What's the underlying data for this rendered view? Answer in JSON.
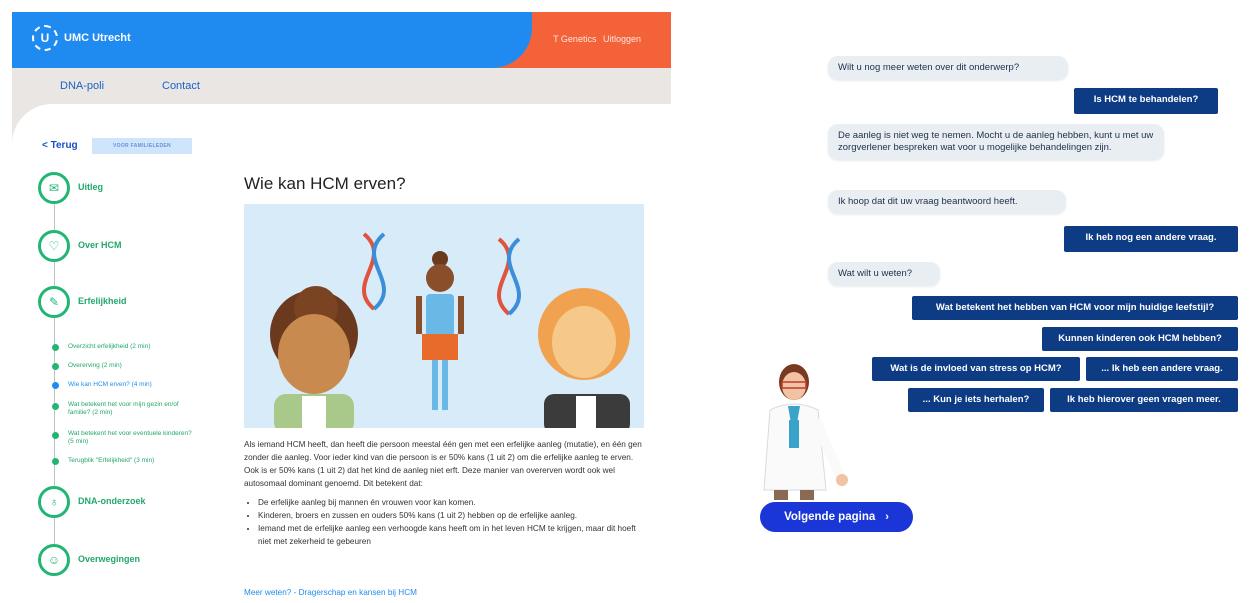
{
  "portal": {
    "brand": "UMC Utrecht",
    "logo_letter": "U",
    "user": {
      "name": "T Genetics",
      "logout": "Uitloggen"
    },
    "nav": [
      "DNA-poli",
      "Contact"
    ],
    "back": "< Terug",
    "badge": "VOOR FAMILIELEDEN",
    "steps": [
      {
        "label": "Uitleg",
        "icon": "envelope-icon"
      },
      {
        "label": "Over HCM",
        "icon": "heart-icon"
      },
      {
        "label": "Erfelijkheid",
        "icon": "dna-icon"
      },
      {
        "label": "DNA-onderzoek",
        "icon": "flask-icon"
      },
      {
        "label": "Overwegingen",
        "icon": "person-icon"
      }
    ],
    "substeps": [
      "Overzicht erfelijkheid (2 min)",
      "Overerving (2 min)",
      "Wie kan HCM erven? (4 min)",
      "Wat betekent het voor mijn gezin en/of familie? (2 min)",
      "Wat betekent het voor eventuele kinderen? (5 min)",
      "Terugblik \"Erfelijkheid\" (3 min)"
    ],
    "title": "Wie kan HCM erven?",
    "paragraph": "Als iemand HCM heeft, dan heeft die persoon meestal één gen met een erfelijke aanleg (mutatie), en één gen zonder die aanleg. Voor ieder kind van die persoon is er 50% kans (1 uit 2) om die erfelijke aanleg te erven. Ook is er 50% kans (1 uit 2) dat het kind de aanleg niet erft. Deze manier van overerven wordt ook wel autosomaal dominant genoemd. Dit betekent dat:",
    "bullets": [
      "De erfelijke aanleg bij mannen én vrouwen voor kan komen.",
      "Kinderen, broers en zussen en ouders 50% kans (1 uit 2) hebben op de erfelijke aanleg.",
      "Iemand met de erfelijke aanleg een verhoogde kans heeft om in het leven HCM te krijgen, maar dit hoeft niet met zekerheid te gebeuren"
    ],
    "more_link": "Meer weten? - Dragerschap en kansen bij HCM"
  },
  "chat": {
    "messages": [
      {
        "from": "bot",
        "text": "Wilt u nog meer weten over dit onderwerp?"
      },
      {
        "from": "user",
        "text": "Is HCM te behandelen?"
      },
      {
        "from": "bot",
        "text": "De aanleg is niet weg te nemen. Mocht u de aanleg hebben, kunt u met uw zorgverlener bespreken wat voor u mogelijke behandelingen zijn."
      },
      {
        "from": "bot",
        "text": "Ik hoop dat dit uw vraag beantwoord heeft."
      },
      {
        "from": "user",
        "text": "Ik heb nog een andere vraag."
      },
      {
        "from": "bot",
        "text": "Wat wilt u weten?"
      }
    ],
    "options": [
      "Wat betekent het hebben van HCM voor mijn huidige leefstijl?",
      "Kunnen kinderen ook HCM hebben?",
      "Wat is de invloed van stress op HCM?",
      "... Ik heb een andere vraag.",
      "... Kun je iets herhalen?",
      "Ik heb hierover geen vragen meer."
    ],
    "next_button": "Volgende pagina",
    "avatar": "doctor-avatar"
  },
  "colors": {
    "brand_blue": "#1f8bf0",
    "accent_orange": "#f4623a",
    "step_green": "#23b574",
    "chat_navy": "#0d3b84",
    "cta_blue": "#1a36d6"
  }
}
